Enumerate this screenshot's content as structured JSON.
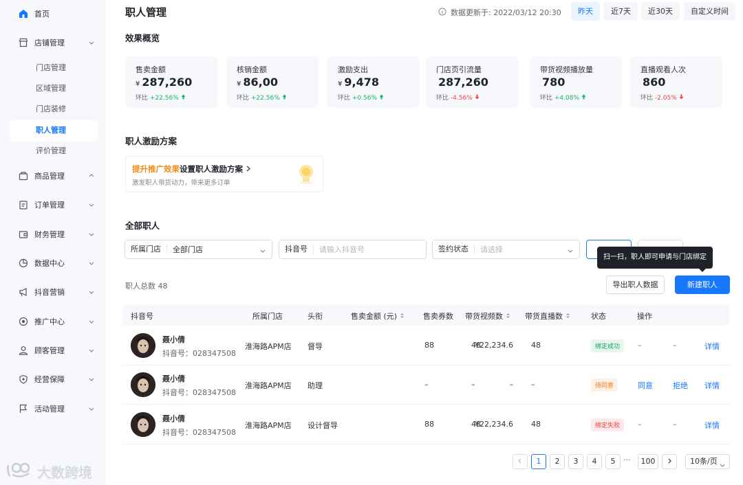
{
  "sidebar": {
    "home": "首页",
    "store_mgmt": "店铺管理",
    "sub_items": [
      "门店管理",
      "区域管理",
      "门店装修",
      "职人管理",
      "评价管理"
    ],
    "items": [
      "商品管理",
      "订单管理",
      "财务管理",
      "数据中心",
      "抖音营销",
      "推广中心",
      "顾客管理",
      "经营保障",
      "活动管理"
    ]
  },
  "watermark": "大数跨境",
  "header": {
    "title": "职人管理",
    "update_text": "数据更新于: 2022/03/12 20:30",
    "ranges": [
      "昨天",
      "近7天",
      "近30天",
      "自定义时间"
    ],
    "active_range": "昨天"
  },
  "overview": {
    "title": "效果概览",
    "cards": [
      {
        "label": "售卖金额",
        "currency": "¥",
        "value": "287,260",
        "trend_label": "环比",
        "trend": "+22.56%",
        "dir": "up"
      },
      {
        "label": "核销金额",
        "currency": "¥",
        "value": "86,00",
        "trend_label": "环比",
        "trend": "+22.56%",
        "dir": "up"
      },
      {
        "label": "激励支出",
        "currency": "¥",
        "value": "9,478",
        "trend_label": "环比",
        "trend": "+0.56%",
        "dir": "up"
      },
      {
        "label": "门店页引流量",
        "currency": "",
        "value": "287,260",
        "trend_label": "环比",
        "trend": "-4.56%",
        "dir": "down"
      },
      {
        "label": "带货视频播放量",
        "currency": "",
        "value": "780",
        "trend_label": "环比",
        "trend": "+4.08%",
        "dir": "up"
      },
      {
        "label": "直播观看人次",
        "currency": "",
        "value": "860",
        "trend_label": "环比",
        "trend": "-2.05%",
        "dir": "down"
      }
    ]
  },
  "incentive": {
    "title": "职人激励方案",
    "highlight": "提升推广效果",
    "rest": "设置职人激励方案",
    "desc": "激发职人带货动力，带来更多订单"
  },
  "all_staff": {
    "title": "全部职人",
    "filters": [
      {
        "label": "所属门店",
        "value": "全部门店",
        "placeholder": ""
      },
      {
        "label": "抖音号",
        "value": "",
        "placeholder": "请输入抖音号"
      },
      {
        "label": "签约状态",
        "value": "",
        "placeholder": "请选择"
      }
    ],
    "tooltip": "扫一扫，职人即可申请与门店绑定",
    "total": "职人总数 48",
    "export_btn": "导出职人数据",
    "new_btn": "新建职人"
  },
  "table": {
    "columns": [
      "抖音号",
      "所属门店",
      "头衔",
      "售卖金额 (元)",
      "售卖券数",
      "带货视频数",
      "带货直播数",
      "状态",
      "操作"
    ],
    "rows": [
      {
        "name": "聂小倩",
        "douyin": "抖音号：028347508",
        "store": "淮海路APM店",
        "title": "督导",
        "amount": "¥22,234.6",
        "coupons": "88",
        "videos": "48",
        "lives": "48",
        "status": "绑定成功",
        "status_type": "ok",
        "op1": "–",
        "op2": "–",
        "op3": "详情"
      },
      {
        "name": "聂小倩",
        "douyin": "抖音号：028347508",
        "store": "淮海路APM店",
        "title": "助理",
        "amount": "–",
        "coupons": "–",
        "videos": "–",
        "lives": "–",
        "status": "待同意",
        "status_type": "wait",
        "op1": "同意",
        "op2": "拒绝",
        "op3": "详情"
      },
      {
        "name": "聂小倩",
        "douyin": "抖音号：028347508",
        "store": "淮海路APM店",
        "title": "设计督导",
        "amount": "¥22,234.6",
        "coupons": "88",
        "videos": "48",
        "lives": "48",
        "status": "绑定失败",
        "status_type": "fail",
        "op1": "–",
        "op2": "–",
        "op3": "详情"
      }
    ]
  },
  "pagination": {
    "pages": [
      "1",
      "2",
      "3",
      "4",
      "5"
    ],
    "ellipsis": "···",
    "last": "100",
    "page_size": "10条/页"
  },
  "colors": {
    "accent": "#1677ff",
    "up": "#13b56a",
    "down": "#f0443c"
  }
}
